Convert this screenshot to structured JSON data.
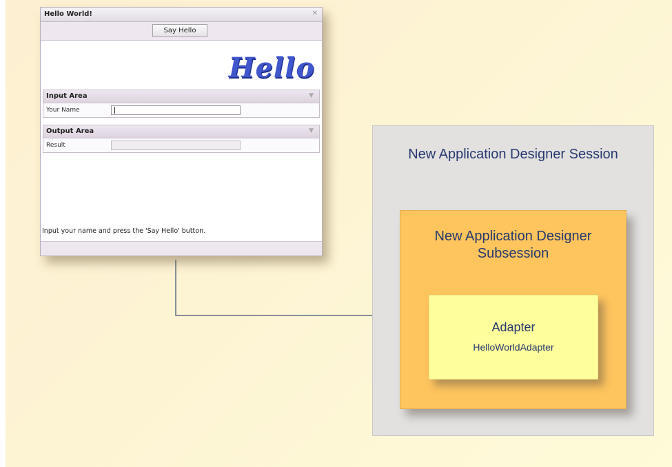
{
  "window": {
    "title": "Hello World!",
    "close_glyph": "✕",
    "say_hello_label": "Say Hello",
    "logo_text": "Hello",
    "input_area": {
      "title": "Input Area",
      "your_name_label": "Your Name",
      "your_name_value": ""
    },
    "output_area": {
      "title": "Output Area",
      "result_label": "Result",
      "result_value": ""
    },
    "status_text": "Input your name and press the 'Say Hello' button."
  },
  "diagram": {
    "session_label": "New Application Designer Session",
    "subsession_label_line1": "New Application Designer",
    "subsession_label_line2": "Subsession",
    "adapter_label": "Adapter",
    "adapter_class": "HelloWorldAdapter"
  },
  "colors": {
    "background": "#fdf4d4",
    "session": "#e2e1e0",
    "subsession": "#fec45e",
    "adapter": "#fefe9c",
    "label_text": "#27396e",
    "connector": "#5f6d84",
    "logo": "#3f56cc"
  }
}
